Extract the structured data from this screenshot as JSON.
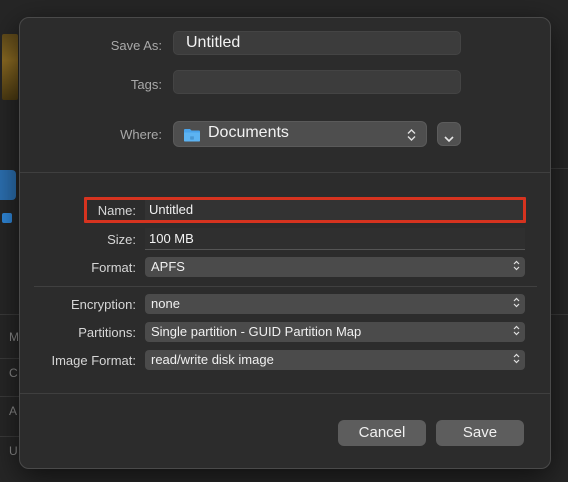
{
  "window": {
    "title": "Save As dialog"
  },
  "top": {
    "save_as_label": "Save As:",
    "save_as_value": "Untitled",
    "tags_label": "Tags:",
    "tags_value": "",
    "where_label": "Where:",
    "where_value": "Documents",
    "where_icon": "folder-icon",
    "expand_icon": "chevron-down-icon"
  },
  "form": {
    "name_label": "Name:",
    "name_value": "Untitled",
    "size_label": "Size:",
    "size_value": "100 MB",
    "format_label": "Format:",
    "format_value": "APFS",
    "encryption_label": "Encryption:",
    "encryption_value": "none",
    "partitions_label": "Partitions:",
    "partitions_value": "Single partition - GUID Partition Map",
    "image_format_label": "Image Format:",
    "image_format_value": "read/write disk image"
  },
  "buttons": {
    "cancel_label": "Cancel",
    "save_label": "Save"
  },
  "background": {
    "letters": [
      "M",
      "C",
      "A",
      "U"
    ]
  },
  "colors": {
    "highlight": "#d6331f",
    "folder": "#4aa3ea"
  }
}
